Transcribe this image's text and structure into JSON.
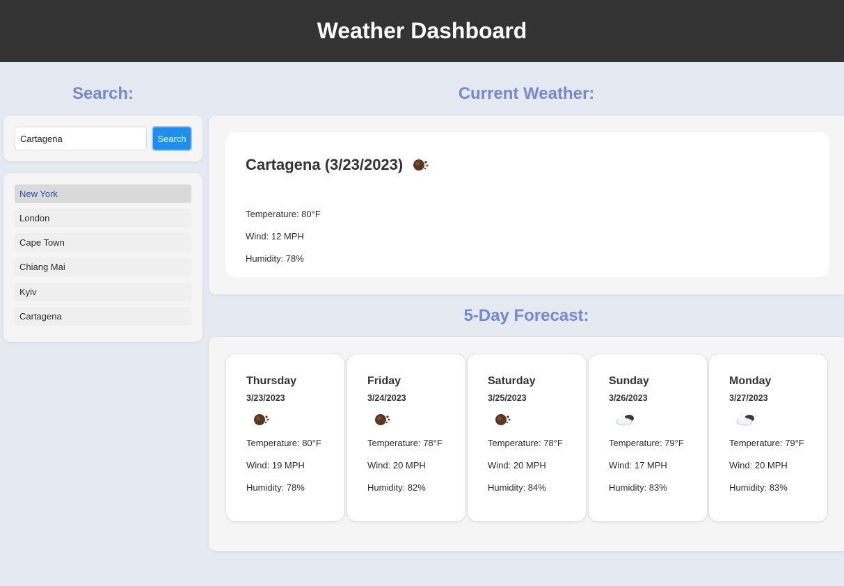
{
  "header": {
    "title": "Weather Dashboard"
  },
  "search": {
    "heading": "Search:",
    "input_value": "Cartagena",
    "button_label": "Search",
    "history": [
      "New York",
      "London",
      "Cape Town",
      "Chiang Mai",
      "Kyiv",
      "Cartagena"
    ],
    "active_index": 0
  },
  "current": {
    "heading": "Current Weather:",
    "title": "Cartagena (3/23/2023)",
    "icon": "rain-icon",
    "temperature": "Temperature: 80°F",
    "wind": "Wind: 12 MPH",
    "humidity": "Humidity: 78%"
  },
  "forecast": {
    "heading": "5-Day Forecast:",
    "days": [
      {
        "day": "Thursday",
        "date": "3/23/2023",
        "icon": "rain-icon",
        "temperature": "Temperature: 80°F",
        "wind": "Wind: 19 MPH",
        "humidity": "Humidity: 78%"
      },
      {
        "day": "Friday",
        "date": "3/24/2023",
        "icon": "rain-icon",
        "temperature": "Temperature: 78°F",
        "wind": "Wind: 20 MPH",
        "humidity": "Humidity: 82%"
      },
      {
        "day": "Saturday",
        "date": "3/25/2023",
        "icon": "rain-icon",
        "temperature": "Temperature: 78°F",
        "wind": "Wind: 20 MPH",
        "humidity": "Humidity: 84%"
      },
      {
        "day": "Sunday",
        "date": "3/26/2023",
        "icon": "cloud-icon",
        "temperature": "Temperature: 79°F",
        "wind": "Wind: 17 MPH",
        "humidity": "Humidity: 83%"
      },
      {
        "day": "Monday",
        "date": "3/27/2023",
        "icon": "cloud-icon",
        "temperature": "Temperature: 79°F",
        "wind": "Wind: 20 MPH",
        "humidity": "Humidity: 83%"
      }
    ]
  },
  "colors": {
    "header_bg": "#333333",
    "page_bg": "#e4e9f2",
    "heading": "#7489d4",
    "search_button": "#1f8ef1",
    "active_link": "#1d57b8"
  }
}
